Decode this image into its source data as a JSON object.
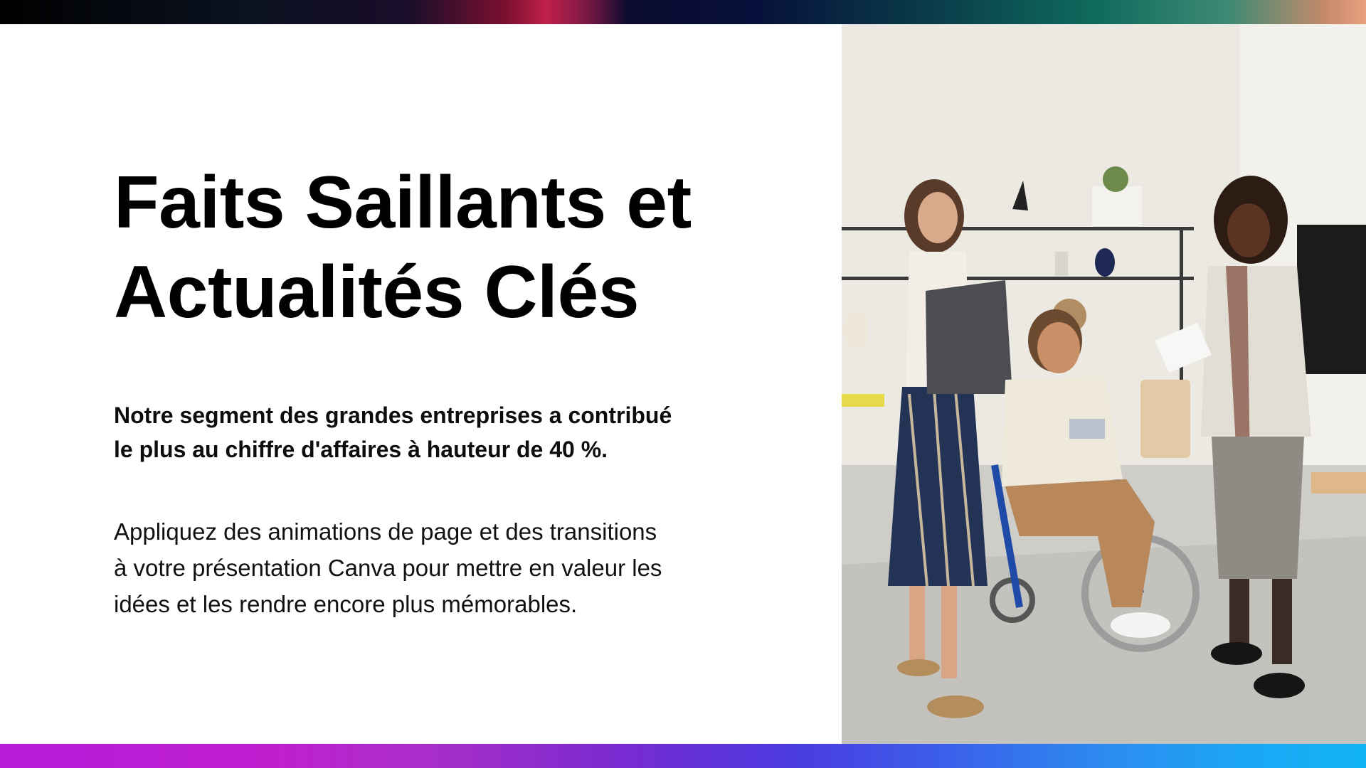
{
  "slide": {
    "title_line1": "Faits Saillants et",
    "title_line2": "Actualités Clés",
    "highlight_line1": "Notre segment des grandes entreprises a contribué",
    "highlight_line2": "le plus au chiffre d'affaires à hauteur de 40 %.",
    "body_line1": "Appliquez des animations de page et des transitions",
    "body_line2": "à votre présentation Canva pour mettre en valeur les",
    "body_line3": "idées et les rendre encore plus mémorables."
  },
  "photo": {
    "subject": "three-colleagues-office-photo"
  },
  "colors": {
    "background": "#ffffff",
    "text": "#000000",
    "top_bar_accent": "#c0204a",
    "bottom_bar_start": "#b51bd8",
    "bottom_bar_end": "#12b4f5"
  }
}
